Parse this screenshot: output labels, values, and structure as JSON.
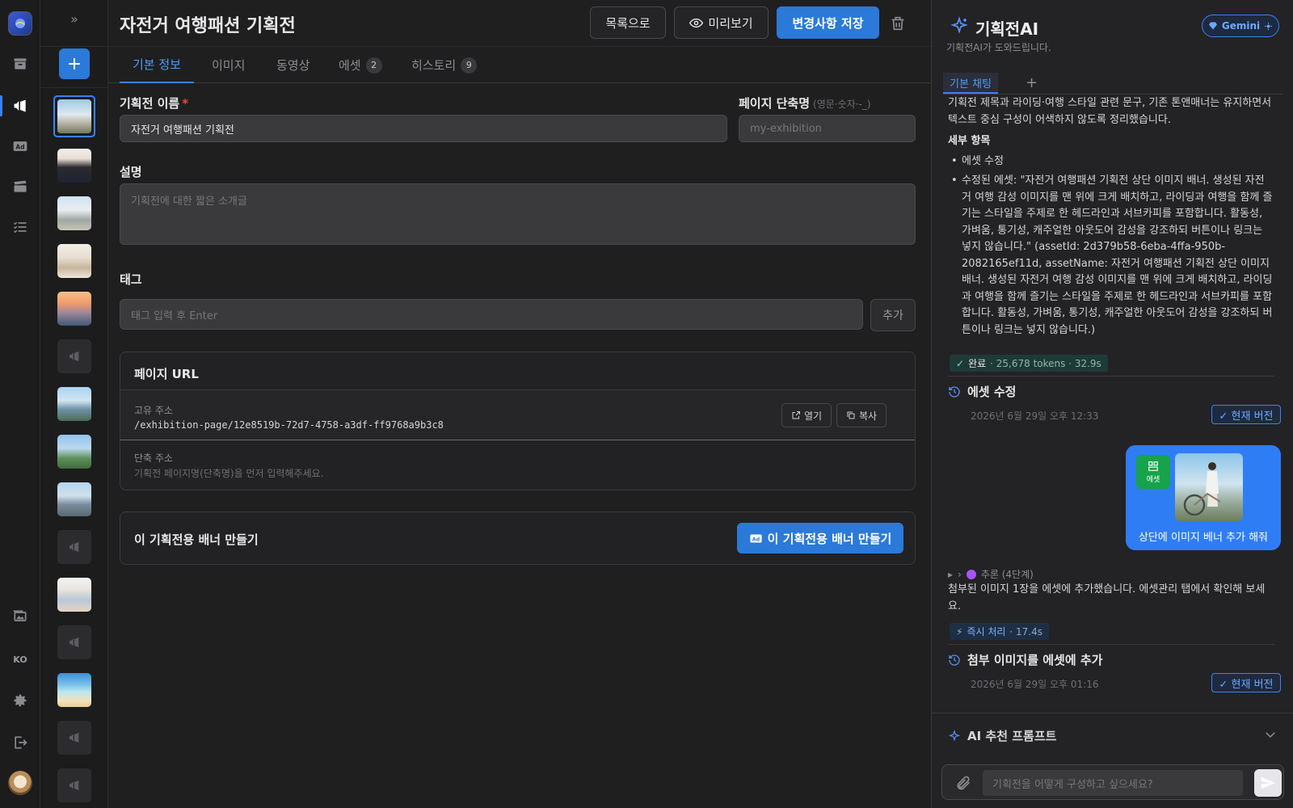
{
  "rail": {
    "language": "KO"
  },
  "main": {
    "title": "자전거 여행패션 기획전",
    "buttons": {
      "list": "목록으로",
      "preview": "미리보기",
      "save": "변경사항 저장"
    },
    "tabs": [
      {
        "label": "기본 정보",
        "badge": ""
      },
      {
        "label": "이미지",
        "badge": ""
      },
      {
        "label": "동영상",
        "badge": ""
      },
      {
        "label": "에셋",
        "badge": "2"
      },
      {
        "label": "히스토리",
        "badge": "9"
      }
    ],
    "form": {
      "name_label": "기획전 이름",
      "name_required": "*",
      "name_value": "자전거 여행패션 기획전",
      "slug_label": "페이지 단축명",
      "slug_hint": "(영문·숫자·-_)",
      "slug_placeholder": "my-exhibition",
      "desc_label": "설명",
      "desc_placeholder": "기획전에 대한 짧은 소개글",
      "tag_label": "태그",
      "tag_placeholder": "태그 입력 후 Enter",
      "tag_add": "추가"
    },
    "url_card": {
      "title": "페이지 URL",
      "unique_label": "고유 주소",
      "unique_value": "/exhibition-page/12e8519b-72d7-4758-a3df-ff9768a9b3c8",
      "open": "열기",
      "copy": "복사",
      "short_label": "단축 주소",
      "short_hint": "기획전 페이지명(단축명)을 먼저 입력해주세요."
    },
    "banner_card": {
      "title": "이 기획전용 배너 만들기",
      "button": "이 기획전용 배너 만들기"
    }
  },
  "ai": {
    "title": "기획전AI",
    "subtitle": "기획전AI가 도와드립니다.",
    "model": "Gemini",
    "tab": "기본 채팅",
    "intro": "기획전 제목과 라이딩·여행 스타일 관련 문구, 기존 톤앤매너는 유지하면서 텍스트 중심 구성이 어색하지 않도록 정리했습니다.",
    "section_title": "세부 항목",
    "item1": "에셋 수정",
    "item2": "수정된 에셋: \"자전거 여행패션 기획전 상단 이미지 배너. 생성된 자전거 여행 감성 이미지를 맨 위에 크게 배치하고, 라이딩과 여행을 함께 즐기는 스타일을 주제로 한 헤드라인과 서브카피를 포함합니다. 활동성, 가벼움, 통기성, 캐주얼한 아웃도어 감성을 강조하되 버튼이나 링크는 넣지 않습니다.\" (assetId: 2d379b58-6eba-4ffa-950b-2082165ef11d, assetName: 자전거 여행패션 기획전 상단 이미지 배너. 생성된 자전거 여행 감성 이미지를 맨 위에 크게 배치하고, 라이딩과 여행을 함께 즐기는 스타일을 주제로 한 헤드라인과 서브카피를 포함합니다. 활동성, 가벼움, 통기성, 캐주얼한 아웃도어 감성을 강조하되 버튼이나 링크는 넣지 않습니다.)",
    "status1": {
      "label": "완료",
      "meta": "· 25,678 tokens · 32.9s"
    },
    "version1": {
      "title": "에셋 수정",
      "date": "2026년 6월 29일 오후 12:33",
      "badge": "✓ 현재 버전"
    },
    "user_msg": {
      "asset_label": "에셋",
      "text": "상단에 이미지 베너 추가 해줘"
    },
    "reasoning": "추론 (4단계)",
    "reply": "첨부된 이미지 1장을 에셋에 추가했습니다. 에셋관리 탭에서 확인해 보세요.",
    "status2": {
      "label": "즉시 처리",
      "meta": "· 17.4s"
    },
    "version2": {
      "title": "첨부 이미지를 에셋에 추가",
      "date": "2026년 6월 29일 오후 01:16",
      "badge": "✓ 현재 버전"
    },
    "reco_title": "AI 추천 프롬프트",
    "input_placeholder": "기획전을 어떻게 구성하고 싶으세요?"
  }
}
